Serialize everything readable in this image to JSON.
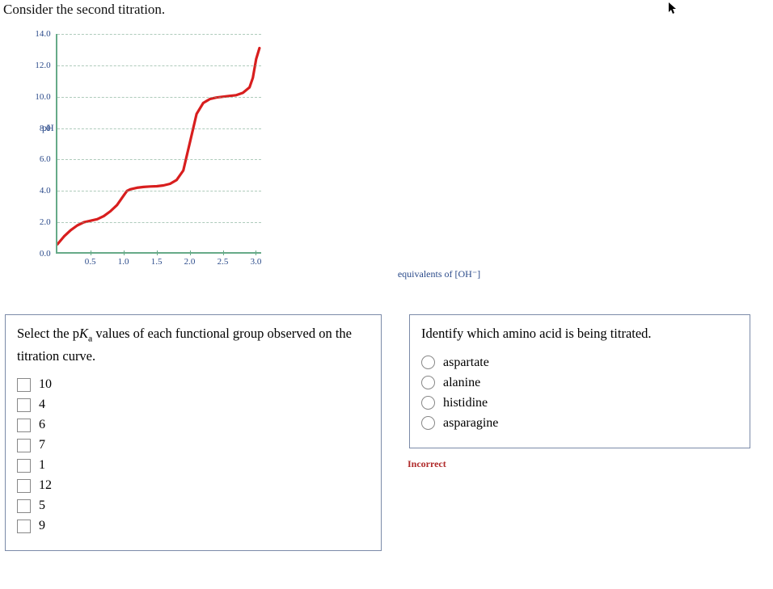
{
  "heading": "Consider the second titration.",
  "chart_data": {
    "type": "line",
    "ylabel": "pH",
    "xlabel": "equivalents of [OH⁻]",
    "yticks": [
      "0.0",
      "2.0",
      "4.0",
      "6.0",
      "8.0",
      "10.0",
      "12.0",
      "14.0"
    ],
    "xticks": [
      "0.5",
      "1.0",
      "1.5",
      "2.0",
      "2.5",
      "3.0"
    ],
    "x": [
      0.0,
      0.05,
      0.1,
      0.2,
      0.3,
      0.4,
      0.5,
      0.6,
      0.7,
      0.8,
      0.9,
      0.95,
      1.0,
      1.05,
      1.1,
      1.2,
      1.3,
      1.4,
      1.5,
      1.6,
      1.7,
      1.8,
      1.9,
      1.95,
      2.0,
      2.05,
      2.1,
      2.2,
      2.3,
      2.4,
      2.5,
      2.6,
      2.7,
      2.8,
      2.9,
      2.95,
      3.0,
      3.05
    ],
    "y": [
      0.6,
      0.85,
      1.1,
      1.5,
      1.8,
      2.0,
      2.1,
      2.2,
      2.4,
      2.7,
      3.1,
      3.4,
      3.7,
      4.0,
      4.1,
      4.2,
      4.25,
      4.28,
      4.3,
      4.35,
      4.45,
      4.7,
      5.3,
      6.2,
      7.1,
      8.0,
      8.9,
      9.6,
      9.85,
      9.95,
      10.0,
      10.05,
      10.1,
      10.25,
      10.6,
      11.2,
      12.4,
      13.1
    ],
    "ylim": [
      0,
      14
    ],
    "xlim": [
      0,
      3.1
    ],
    "grid_y": [
      2,
      4,
      6,
      8,
      10,
      12,
      14
    ]
  },
  "question1": {
    "prompt_pre": "Select the p",
    "prompt_K": "K",
    "prompt_sub": "a",
    "prompt_post": " values of each functional group observed on the titration curve.",
    "options": [
      "10",
      "4",
      "6",
      "7",
      "1",
      "12",
      "5",
      "9"
    ]
  },
  "question2": {
    "prompt": "Identify which amino acid is being titrated.",
    "options": [
      "aspartate",
      "alanine",
      "histidine",
      "asparagine"
    ],
    "feedback": "Incorrect"
  }
}
